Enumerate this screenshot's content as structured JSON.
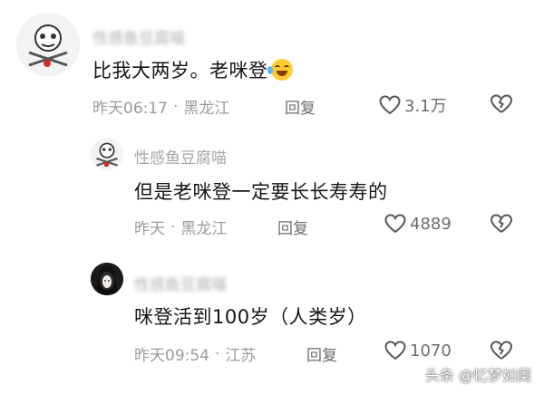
{
  "comments": [
    {
      "username": "性感鱼豆腐喵",
      "text": "比我大两岁。老咪登",
      "emoji": "rolling-laughing-emoji",
      "time": "昨天06:17",
      "location": "黑龙江",
      "reply": "回复",
      "likes": "3.1万"
    },
    {
      "username": "性感鱼豆腐喵",
      "text": "但是老咪登一定要长长寿寿的",
      "time": "昨天",
      "location": "黑龙江",
      "reply": "回复",
      "likes": "4889"
    },
    {
      "username": "性感鱼豆腐喵",
      "text": "咪登活到100岁（人类岁）",
      "time": "昨天09:54",
      "location": "江苏",
      "reply": "回复",
      "likes": "1070"
    }
  ],
  "separator": "·",
  "watermark": "头条 @忆梦如阑",
  "colors": {
    "text": "#151515",
    "meta": "#9b9b9b",
    "action": "#6d6d6d"
  }
}
